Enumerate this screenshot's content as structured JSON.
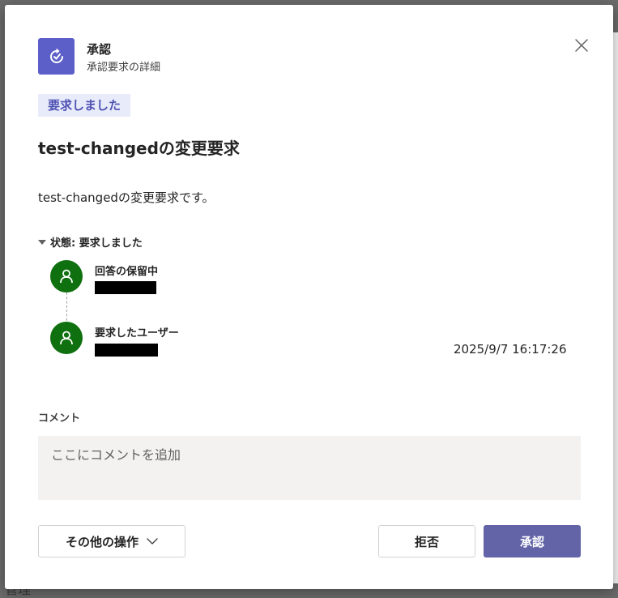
{
  "backdrop": {
    "partial_text": "管理"
  },
  "header": {
    "app_name": "承認",
    "subtitle": "承認要求の詳細",
    "app_icon": "approvals-icon",
    "close_icon": "close-icon"
  },
  "status_pill": "要求しました",
  "request": {
    "title": "test-changedの変更要求",
    "description": "test-changedの変更要求です。"
  },
  "status_section": {
    "label": "状態: 要求しました",
    "steps": [
      {
        "label": "回答の保留中",
        "user": "",
        "timestamp": ""
      },
      {
        "label": "要求したユーザー",
        "user": "",
        "timestamp": "2025/9/7 16:17:26"
      }
    ]
  },
  "comment": {
    "label": "コメント",
    "placeholder": "ここにコメントを追加",
    "value": ""
  },
  "actions": {
    "more_label": "その他の操作",
    "reject_label": "拒否",
    "approve_label": "承認"
  },
  "colors": {
    "accent": "#5b5fc7",
    "primary_button": "#6264a7",
    "avatar": "#0e700e",
    "pill_bg": "#e8ebfa",
    "pill_text": "#4f52b2"
  }
}
